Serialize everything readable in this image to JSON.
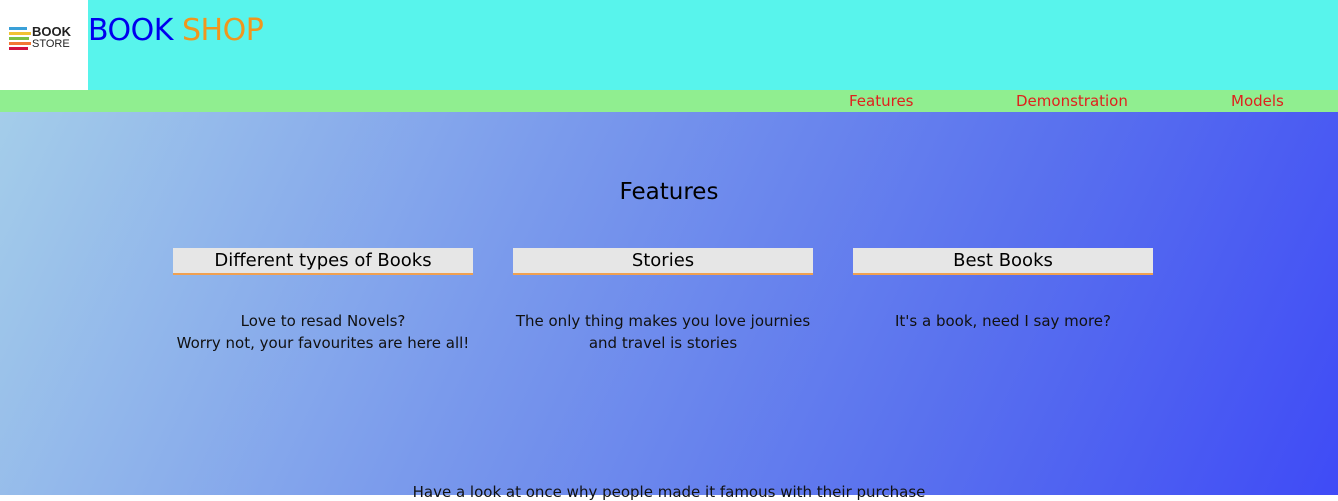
{
  "header": {
    "logo": {
      "line1": "BOOK",
      "line2": "STORE",
      "stripe_colors": [
        "#3aa0d8",
        "#f2c233",
        "#7bc043",
        "#f37735",
        "#d11141"
      ]
    },
    "brand": {
      "part1": "BOOK",
      "part2": "SHOP",
      "colors": {
        "part1": "#0000ee",
        "part2": "#f0961e"
      }
    },
    "background": "#58f4ec"
  },
  "nav": {
    "background": "#90ee90",
    "link_color": "#e0201c",
    "items": [
      {
        "label": "Features"
      },
      {
        "label": "Demonstration"
      },
      {
        "label": "Models"
      }
    ]
  },
  "main": {
    "section_title": "Features",
    "cards": [
      {
        "title": "Different types of Books",
        "lines": [
          "Love to resad Novels?",
          "Worry not, your favourites are here all!"
        ]
      },
      {
        "title": "Stories",
        "lines": [
          "The only thing makes you love journies",
          "and travel is stories"
        ]
      },
      {
        "title": "Best Books",
        "lines": [
          "It's a book, need I say more?"
        ]
      }
    ],
    "bottom_text": "Have a look at once why people made it famous with their purchase"
  }
}
